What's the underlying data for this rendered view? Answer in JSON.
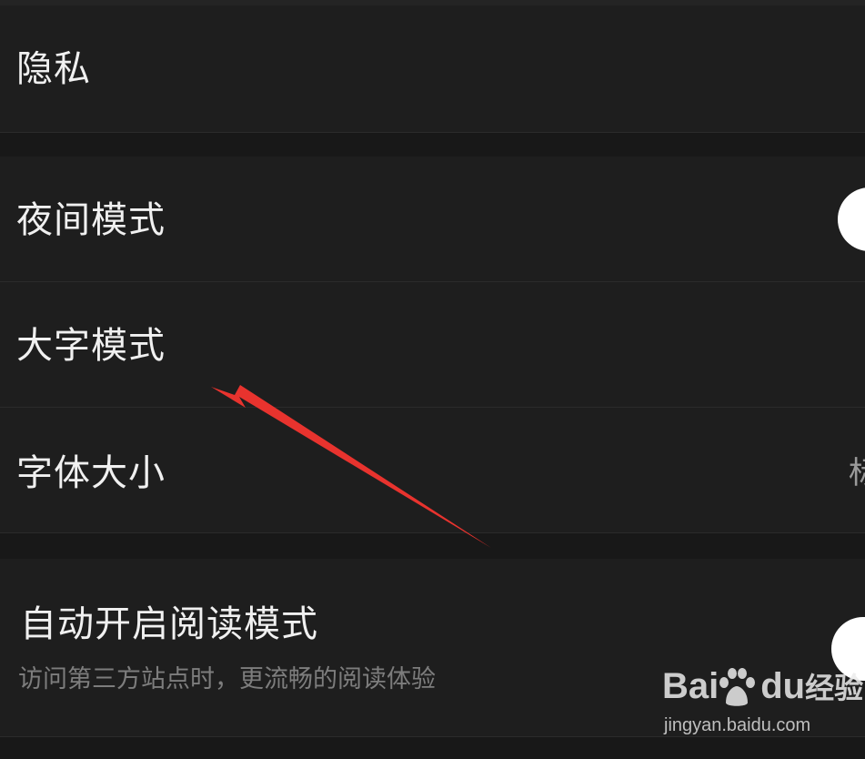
{
  "settings": {
    "privacy_label": "隐私",
    "night_mode_label": "夜间模式",
    "large_text_label": "大字模式",
    "font_size_label": "字体大小",
    "font_size_value": "标",
    "auto_reader_label": "自动开启阅读模式",
    "auto_reader_desc": "访问第三方站点时，更流畅的阅读体验"
  },
  "toggles": {
    "night_mode_on": false,
    "auto_reader_on": false
  },
  "annotation": {
    "arrow_color": "#e8332e"
  },
  "watermark": {
    "brand_left": "Bai",
    "brand_mid": "du",
    "brand_right": "经验",
    "url": "jingyan.baidu.com"
  },
  "colors": {
    "background": "#1c1c1c",
    "row_background": "#1e1e1e",
    "text_primary": "#f0f0f0",
    "text_secondary": "#7d7d7d"
  }
}
